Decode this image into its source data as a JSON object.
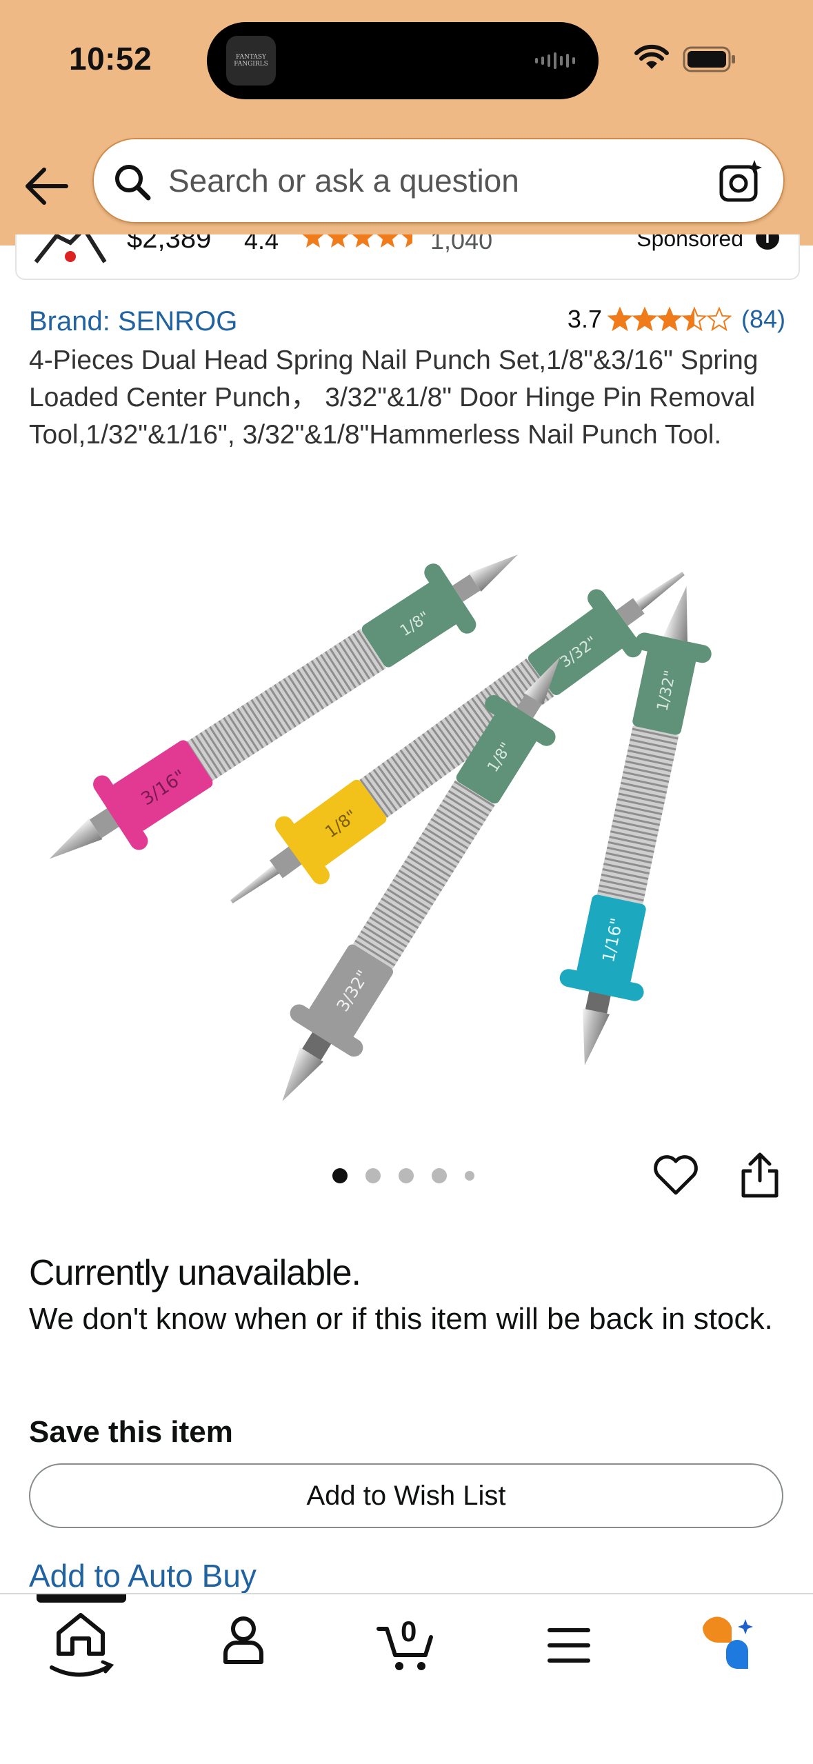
{
  "status_bar": {
    "time": "10:52",
    "app_icon_text": "FANTASY FANGIRLS"
  },
  "search": {
    "placeholder": "Search or ask a question"
  },
  "sponsored": {
    "price": "$2,389",
    "rating": "4.4",
    "review_count": "1,040",
    "label": "Sponsored"
  },
  "product": {
    "brand": "Brand: SENROG",
    "rating_value": "3.7",
    "rating_stars": 3.7,
    "review_count": "(84)",
    "title": "4-Pieces Dual Head Spring Nail Punch Set,1/8\"&3/16\" Spring Loaded Center Punch， 3/32\"&1/8\" Door Hinge Pin Removal Tool,1/32\"&1/16\", 3/32\"&1/8\"Hammerless Nail Punch Tool.",
    "image_labels": [
      "3/16\"",
      "1/8\"",
      "1/8\"",
      "3/32\"",
      "3/32\"",
      "1/8\"",
      "1/32\"",
      "1/16\""
    ]
  },
  "carousel": {
    "total": 5,
    "active": 1
  },
  "availability": {
    "title": "Currently unavailable.",
    "description": "We don't know when or if this item will be back in stock."
  },
  "save": {
    "heading": "Save this item",
    "wish_list_button": "Add to Wish List",
    "auto_buy_link": "Add to Auto Buy"
  },
  "bottom_nav": {
    "cart_count": "0",
    "items": [
      "home-icon",
      "account-icon",
      "cart-icon",
      "menu-icon",
      "rufus-icon"
    ]
  },
  "colors": {
    "header_bg": "#efb985",
    "link": "#2162a1",
    "star": "#f3a847",
    "handle_green": "#5f9278",
    "pink": "#e23a92",
    "yellow": "#f2c11a",
    "gray": "#9b9b9b",
    "teal": "#1ca8bf"
  }
}
